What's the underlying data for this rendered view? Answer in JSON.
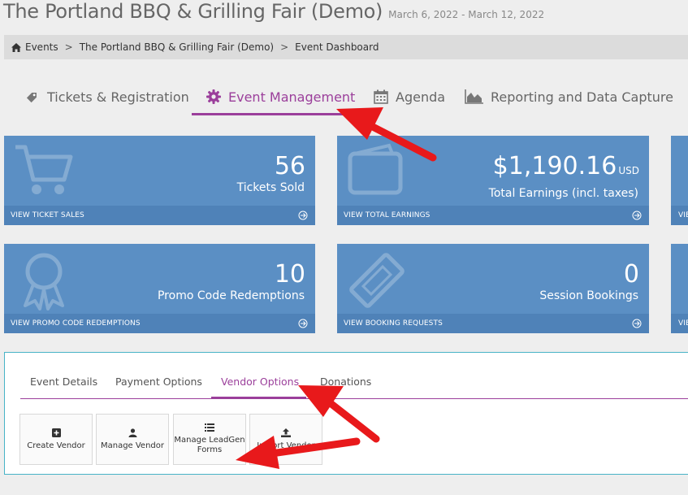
{
  "header": {
    "title": "The Portland BBQ & Grilling Fair (Demo)",
    "dates": "March 6, 2022 - March 12, 2022"
  },
  "breadcrumb": {
    "items": [
      "Events",
      "The Portland BBQ & Grilling Fair (Demo)",
      "Event Dashboard"
    ],
    "separator": ">"
  },
  "main_tabs": [
    {
      "label": "Tickets & Registration",
      "icon": "tag-icon"
    },
    {
      "label": "Event Management",
      "icon": "gear-icon",
      "active": true
    },
    {
      "label": "Agenda",
      "icon": "calendar-icon"
    },
    {
      "label": "Reporting and Data Capture",
      "icon": "area-chart-icon"
    }
  ],
  "stats": {
    "tickets": {
      "value": "56",
      "label": "Tickets Sold",
      "link": "VIEW TICKET SALES"
    },
    "earnings": {
      "value": "$1,190.16",
      "unit": "USD",
      "label": "Total Earnings (incl. taxes)",
      "link": "VIEW TOTAL EARNINGS"
    },
    "promo": {
      "value": "10",
      "label": "Promo Code Redemptions",
      "link": "VIEW PROMO CODE REDEMPTIONS"
    },
    "sessions": {
      "value": "0",
      "label": "Session Bookings",
      "link": "VIEW BOOKING REQUESTS"
    },
    "partial_links": [
      "VIE",
      "VIE"
    ]
  },
  "sub_tabs": [
    {
      "label": "Event Details"
    },
    {
      "label": "Payment Options"
    },
    {
      "label": "Vendor Options",
      "active": true
    },
    {
      "label": "Donations"
    }
  ],
  "vendor_actions": [
    {
      "label": "Create Vendor",
      "icon": "plus-square-icon"
    },
    {
      "label": "Manage Vendor",
      "icon": "user-icon"
    },
    {
      "label": "Manage LeadGen Forms",
      "icon": "list-icon"
    },
    {
      "label": "Import Vendor",
      "icon": "upload-icon"
    }
  ],
  "colors": {
    "accent": "#9b3f9b",
    "card": "#5b8fc4",
    "card_footer": "#4f82b8",
    "panel_border": "#48b3c7",
    "annotation_arrow": "#e8191b"
  }
}
